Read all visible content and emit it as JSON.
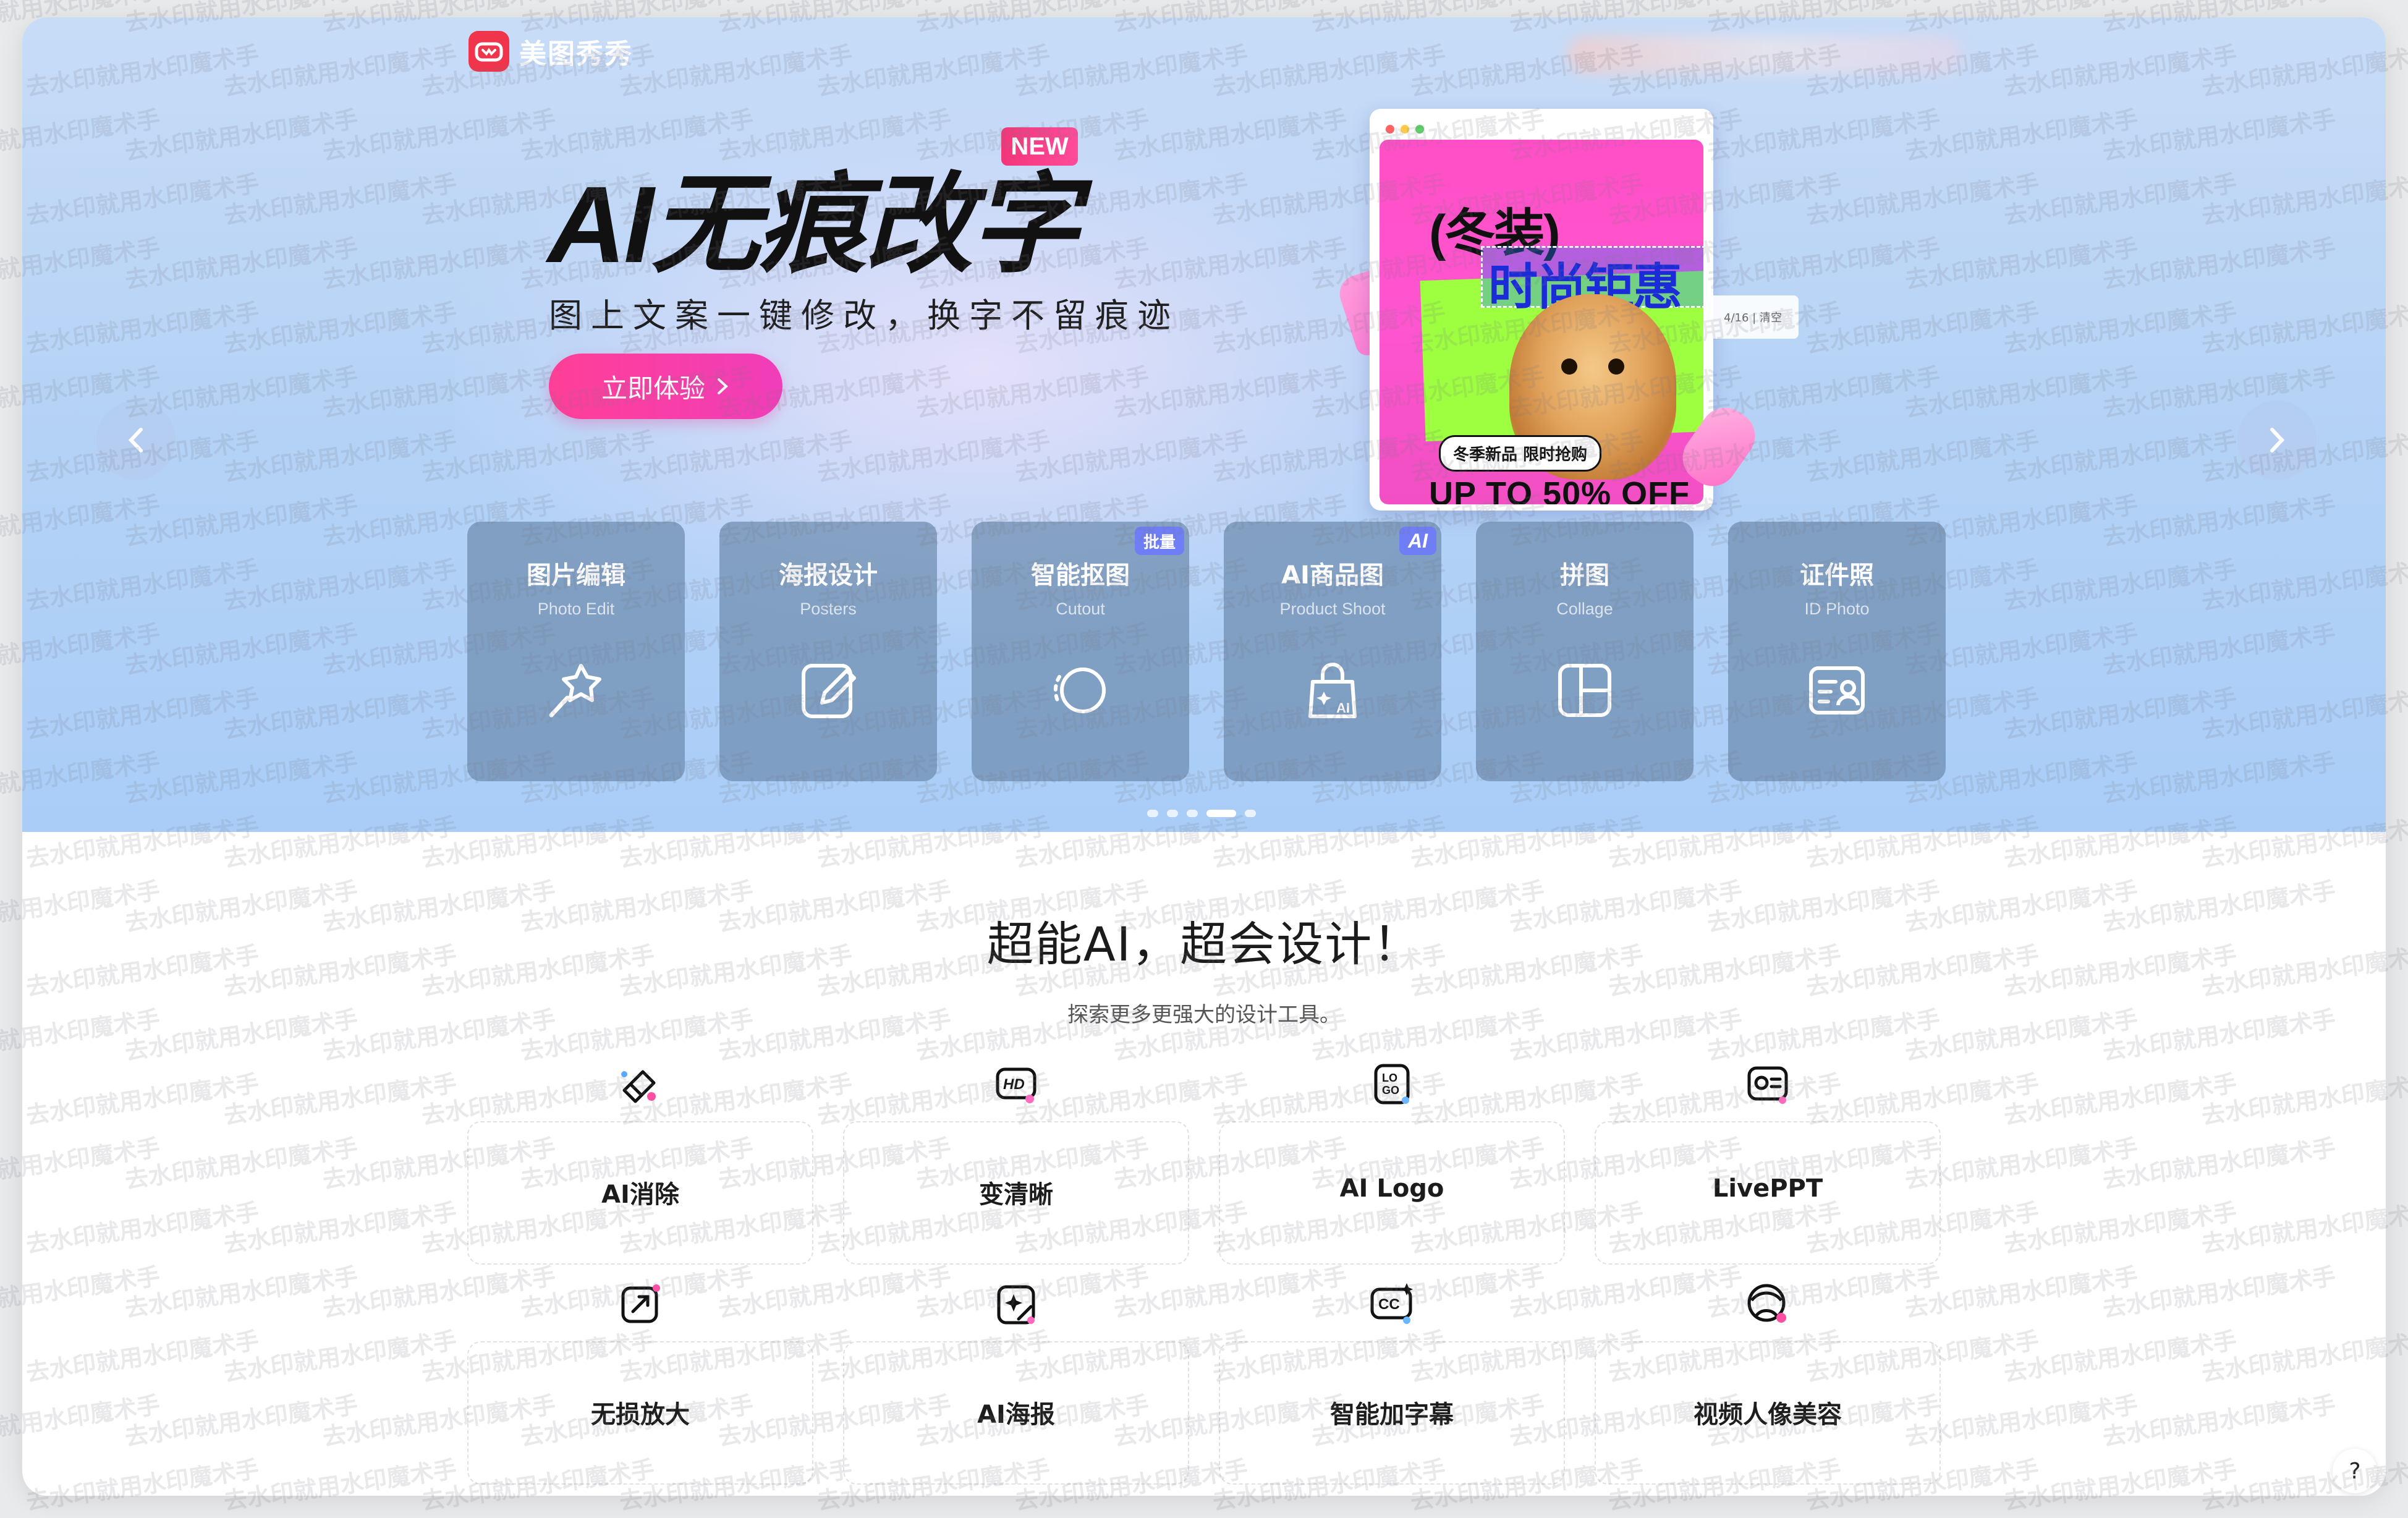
{
  "app": {
    "brand": "美图秀秀"
  },
  "hero": {
    "badge": "NEW",
    "title": "AI无痕改字",
    "subtitle": "图上文案一键修改，换字不留痕迹",
    "cta_label": "立即体验",
    "poster": {
      "headline": "(冬装)",
      "selected_text": "时尚钜惠",
      "tag": "冬季新品 限时抢购",
      "offer": "UP TO 50% OFF",
      "side_counter": "4/16 | 清空"
    }
  },
  "tools": [
    {
      "title": "图片编辑",
      "en": "Photo Edit",
      "icon": "magic-wand-icon",
      "badge": ""
    },
    {
      "title": "海报设计",
      "en": "Posters",
      "icon": "edit-note-icon",
      "badge": ""
    },
    {
      "title": "智能抠图",
      "en": "Cutout",
      "icon": "lasso-icon",
      "badge": "批量"
    },
    {
      "title": "AI商品图",
      "en": "Product Shoot",
      "icon": "shopping-bag-ai-icon",
      "badge": "AI"
    },
    {
      "title": "拼图",
      "en": "Collage",
      "icon": "collage-layout-icon",
      "badge": ""
    },
    {
      "title": "证件照",
      "en": "ID Photo",
      "icon": "id-card-icon",
      "badge": ""
    }
  ],
  "carousel": {
    "total": 5,
    "active": 3
  },
  "section": {
    "title": "超能AI，超会设计！",
    "subtitle": "探索更多更强大的设计工具。"
  },
  "features": [
    {
      "label": "AI消除",
      "icon": "eraser-icon"
    },
    {
      "label": "变清晰",
      "icon": "hd-icon"
    },
    {
      "label": "AI Logo",
      "icon": "logo-icon"
    },
    {
      "label": "LivePPT",
      "icon": "presentation-icon"
    },
    {
      "label": "无损放大",
      "icon": "upscale-icon"
    },
    {
      "label": "AI海报",
      "icon": "ai-poster-icon"
    },
    {
      "label": "智能加字幕",
      "icon": "caption-icon"
    },
    {
      "label": "视频人像美容",
      "icon": "portrait-beauty-icon"
    }
  ],
  "help": {
    "label": "?"
  },
  "watermark": {
    "text": "去水印就用水印魔术手"
  }
}
